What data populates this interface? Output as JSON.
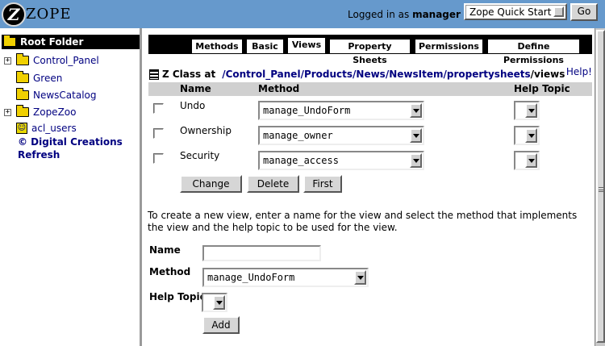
{
  "topbar": {
    "logo_letter": "Z",
    "logo_text": "ZOPE",
    "logged_in_prefix": "Logged in as",
    "username": "manager",
    "quick_start_value": "Zope Quick Start",
    "go_label": "Go"
  },
  "tree": {
    "root_label": "Root Folder",
    "items": [
      {
        "label": "Control_Panel",
        "expandable": true,
        "icon": "folder-icon"
      },
      {
        "label": "Green",
        "expandable": false,
        "icon": "folder-icon"
      },
      {
        "label": "NewsCatalog",
        "expandable": false,
        "icon": "folder-icon"
      },
      {
        "label": "ZopeZoo",
        "expandable": true,
        "icon": "folder-icon"
      },
      {
        "label": "acl_users",
        "expandable": false,
        "icon": "user-folder-icon"
      }
    ],
    "copyright": "© Digital Creations",
    "refresh": "Refresh"
  },
  "tabs": [
    {
      "label": "Methods",
      "active": false
    },
    {
      "label": "Basic",
      "active": false
    },
    {
      "label": "Views",
      "active": true
    },
    {
      "label": "Property Sheets",
      "active": false
    },
    {
      "label": "Permissions",
      "active": false
    },
    {
      "label": "Define Permissions",
      "active": false
    }
  ],
  "breadcrumb": {
    "prefix": "Z Class at",
    "parts": [
      "/Control_Panel",
      "/Products",
      "/News",
      "/NewsItem",
      "/propertysheets",
      "/views"
    ]
  },
  "help_link": "Help!",
  "table": {
    "headers": {
      "name": "Name",
      "method": "Method",
      "help_topic": "Help Topic"
    },
    "rows": [
      {
        "name": "Undo",
        "method": "manage_UndoForm",
        "help_topic": ""
      },
      {
        "name": "Ownership",
        "method": "manage_owner",
        "help_topic": ""
      },
      {
        "name": "Security",
        "method": "manage_access",
        "help_topic": ""
      }
    ]
  },
  "actions": {
    "change": "Change",
    "delete": "Delete",
    "first": "First"
  },
  "new_view": {
    "instructions": "To create a new view, enter a name for the view and select the method that implements the view and the help topic to be used for the view.",
    "name_label": "Name",
    "name_value": "",
    "method_label": "Method",
    "method_value": "manage_UndoForm",
    "help_topic_label": "Help Topic",
    "add_label": "Add"
  }
}
